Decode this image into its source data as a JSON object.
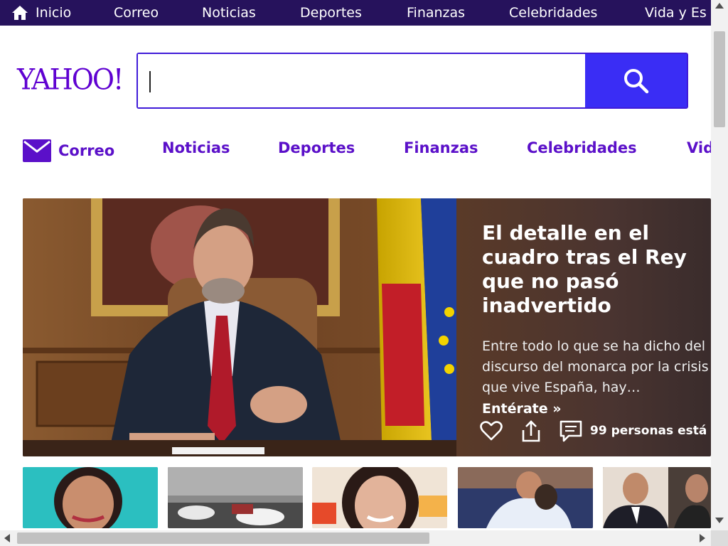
{
  "colors": {
    "topnav_bg": "#26125c",
    "brand_purple": "#5f01d1",
    "search_button": "#3a2df5",
    "link_purple": "#5b10c9"
  },
  "topnav": {
    "items": [
      {
        "label": "Inicio",
        "icon": "home-icon"
      },
      {
        "label": "Correo"
      },
      {
        "label": "Noticias"
      },
      {
        "label": "Deportes"
      },
      {
        "label": "Finanzas"
      },
      {
        "label": "Celebridades"
      },
      {
        "label": "Vida y Es"
      }
    ]
  },
  "logo": {
    "text": "YAHOO!"
  },
  "search": {
    "value": "",
    "placeholder": "",
    "button_icon": "search-icon"
  },
  "secnav": {
    "items": [
      {
        "label": "Correo",
        "icon": "mail-icon"
      },
      {
        "label": "Noticias"
      },
      {
        "label": "Deportes"
      },
      {
        "label": "Finanzas"
      },
      {
        "label": "Celebridades"
      },
      {
        "label": "Vid"
      }
    ]
  },
  "hero": {
    "title": "El detalle en el cuadro tras el Rey que no pasó inadvertido",
    "summary": "Entre todo lo que se ha dicho del discurso del monarca por la crisis que vive España, hay…",
    "cta": "Entérate »",
    "reactions": "99 personas está"
  }
}
